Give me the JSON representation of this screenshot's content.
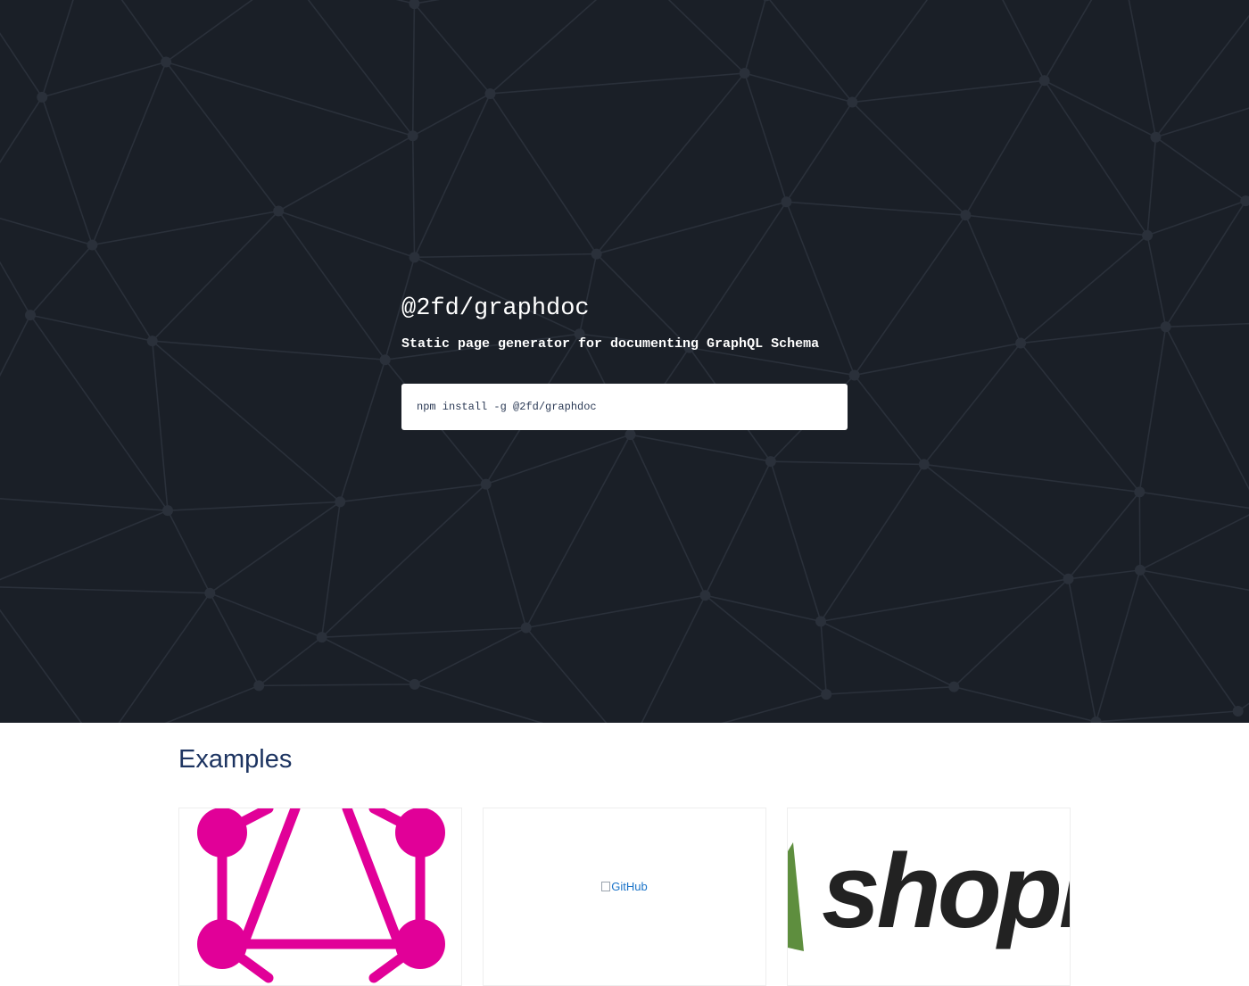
{
  "hero": {
    "title": "@2fd/graphdoc",
    "subtitle": "Static page generator for documenting GraphQL Schema",
    "install_command": "npm install -g @2fd/graphdoc",
    "background_color": "#1a1f27",
    "mesh_color": "#2a303a"
  },
  "examples": {
    "title": "Examples",
    "cards": [
      {
        "logo": "graphql-logo",
        "color": "#e10098"
      },
      {
        "logo": "github-logo",
        "alt_text": "GitHub",
        "image_broken": true
      },
      {
        "logo": "shopify-logo",
        "visible_text": "shopi"
      }
    ]
  },
  "colors": {
    "heading": "#1d3461",
    "link": "#1a73c8"
  }
}
